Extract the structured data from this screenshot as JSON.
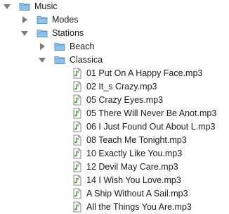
{
  "tree": {
    "root": {
      "label": "Music",
      "icon": "folder-icon",
      "expanded": true
    },
    "modes": {
      "label": "Modes",
      "icon": "folder-icon",
      "expanded": false
    },
    "stations": {
      "label": "Stations",
      "icon": "folder-icon",
      "expanded": true
    },
    "beach": {
      "label": "Beach",
      "icon": "folder-icon",
      "expanded": false
    },
    "classica": {
      "label": "Classica",
      "icon": "folder-icon",
      "expanded": true,
      "files": [
        {
          "label": "01 Put On A Happy Face.mp3",
          "icon": "audio-file-icon"
        },
        {
          "label": "02 It_s Crazy.mp3",
          "icon": "audio-file-icon"
        },
        {
          "label": "05 Crazy Eyes.mp3",
          "icon": "audio-file-icon"
        },
        {
          "label": "05 There Will Never Be Anot.mp3",
          "icon": "audio-file-icon"
        },
        {
          "label": "06 I Just Found Out About L.mp3",
          "icon": "audio-file-icon"
        },
        {
          "label": "08 Teach Me Tonight.mp3",
          "icon": "audio-file-icon"
        },
        {
          "label": "10 Exactly Like You.mp3",
          "icon": "audio-file-icon"
        },
        {
          "label": "12 Devil May Care.mp3",
          "icon": "audio-file-icon"
        },
        {
          "label": "14 I Wish You Love.mp3",
          "icon": "audio-file-icon"
        },
        {
          "label": "A Ship Without A Sail.mp3",
          "icon": "audio-file-icon"
        },
        {
          "label": "All the Things You Are.mp3",
          "icon": "audio-file-icon"
        }
      ]
    }
  },
  "colors": {
    "folder_fill": "#8fc3ec",
    "folder_stroke": "#5f98c8",
    "disclosure": "#7a7a7a",
    "file_note": "#3f9b2e"
  }
}
